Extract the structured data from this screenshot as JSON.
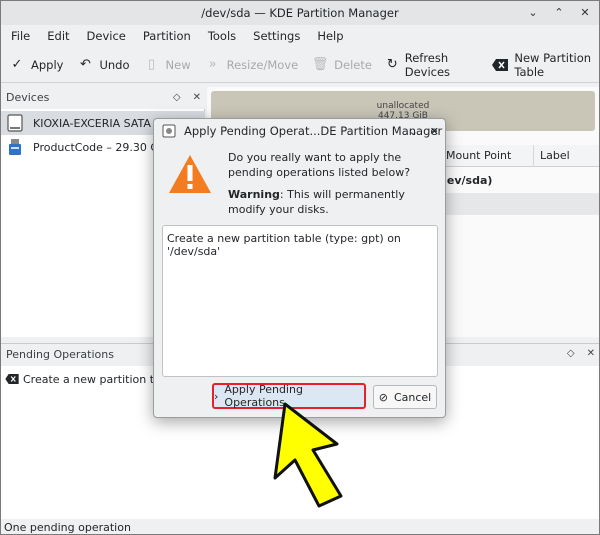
{
  "window": {
    "title": "/dev/sda — KDE Partition Manager"
  },
  "menu": [
    "File",
    "Edit",
    "Device",
    "Partition",
    "Tools",
    "Settings",
    "Help"
  ],
  "toolbar": {
    "apply": "Apply",
    "undo": "Undo",
    "new": "New",
    "resize_move": "Resize/Move",
    "delete": "Delete",
    "refresh": "Refresh Devices",
    "new_table": "New Partition Table"
  },
  "devices": {
    "header": "Devices",
    "items": [
      {
        "label": "KIOXIA-EXCERIA SATA SSD"
      },
      {
        "label": "ProductCode – 29.30 GiB"
      }
    ]
  },
  "partition_map": {
    "label": "unallocated",
    "size": "447.13 GiB"
  },
  "table": {
    "columns": [
      "Mount Point",
      "Label"
    ],
    "row": "dev/sda)"
  },
  "pending": {
    "header": "Pending Operations",
    "items": [
      "Create a new partition table (type: gpt) on '/dev/sda'"
    ]
  },
  "status": "One pending operation",
  "dialog": {
    "title": "Apply Pending Operat...DE Partition Manager",
    "question": "Do you really want to apply the pending operations listed below?",
    "warning_bold": "Warning",
    "warning_text": ": This will permanently modify your disks.",
    "list": [
      "Create a new partition table (type: gpt) on '/dev/sda'"
    ],
    "apply_button": "Apply Pending Operations",
    "cancel_button": "Cancel"
  },
  "colors": {
    "highlight_border": "#e8202a",
    "arrow_fill": "#ffff00",
    "warning": "#f47c20"
  }
}
